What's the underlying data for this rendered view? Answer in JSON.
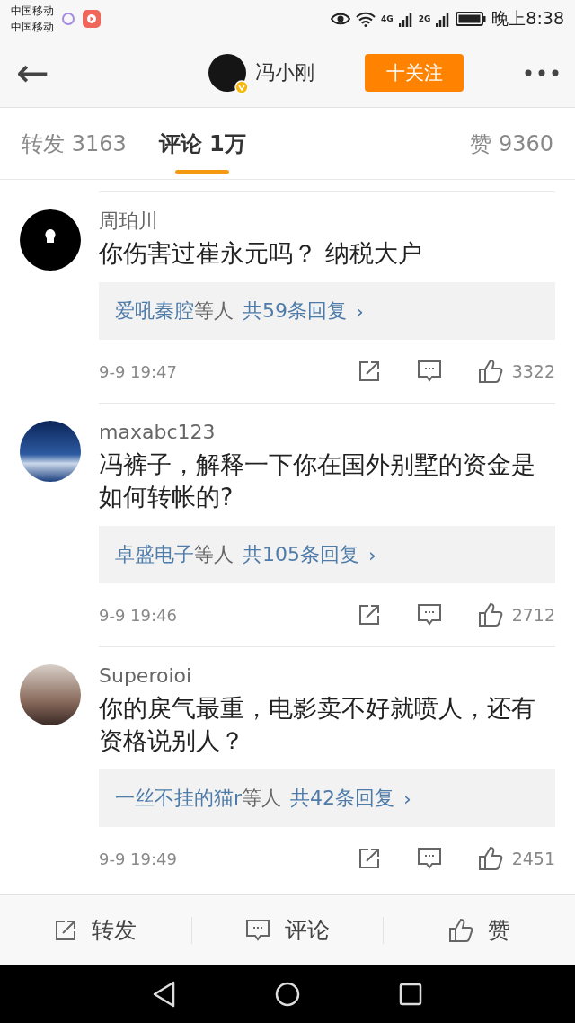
{
  "status_bar": {
    "carriers": [
      "中国移动",
      "中国移动"
    ],
    "network_labels": [
      "4G",
      "2G"
    ],
    "time": "晚上8:38"
  },
  "header": {
    "back": "←",
    "user_name": "冯小刚",
    "verified": true,
    "follow_button": "十关注"
  },
  "tabs": [
    {
      "label": "转发",
      "count": "3163",
      "selected": false
    },
    {
      "label": "评论",
      "count": "1万",
      "selected": true
    },
    {
      "label": "赞",
      "count": "9360",
      "selected": false
    }
  ],
  "comments": [
    {
      "author": "周珀川",
      "kind": "bulb",
      "text": "你伤害过崔永元吗？ 纳税大户",
      "replies": {
        "users": "爱吼秦腔",
        "suffix": "等人",
        "total": "共59条回复",
        "chevron": "›"
      },
      "time": "9-9 19:47",
      "likes": "3322"
    },
    {
      "author": "maxabc123",
      "kind": "wave",
      "text": "冯裤子，解释一下你在国外别墅的资金是如何转帐的?",
      "replies": {
        "users": "卓盛电子",
        "suffix": "等人",
        "total": "共105条回复",
        "chevron": "›"
      },
      "time": "9-9 19:46",
      "likes": "2712"
    },
    {
      "author": "Superoioi",
      "kind": "photo",
      "text": "你的戾气最重，电影卖不好就喷人，还有资格说别人？",
      "replies": {
        "users": "一丝不挂的猫r",
        "suffix": "等人",
        "total": "共42条回复",
        "chevron": "›"
      },
      "time": "9-9 19:49",
      "likes": "2451"
    }
  ],
  "bottom_bar": [
    {
      "kind": "repost",
      "label": "转发"
    },
    {
      "kind": "comment",
      "label": "评论"
    },
    {
      "kind": "like",
      "label": "赞"
    }
  ]
}
